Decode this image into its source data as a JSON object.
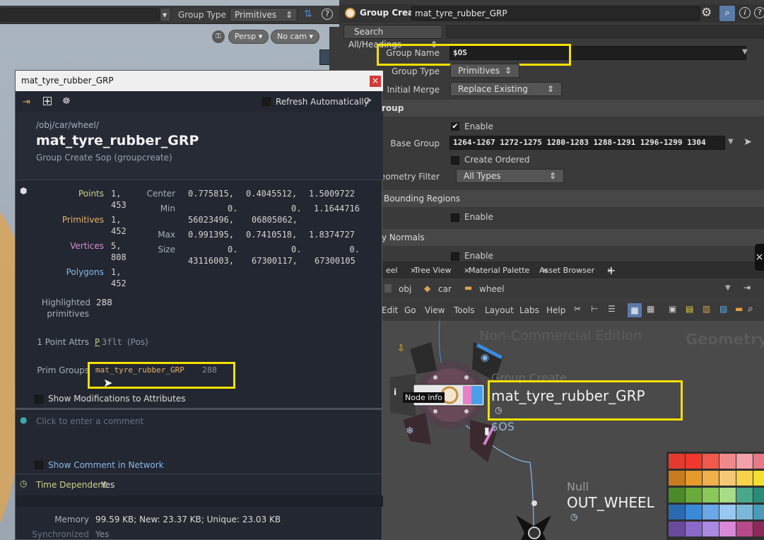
{
  "viewport": {
    "group_type_label": "Group Type",
    "group_type_value": "Primitives",
    "persp": "Persp",
    "nocam": "No cam"
  },
  "param": {
    "node_type": "Group Create",
    "node_name": "mat_tyre_rubber_GRP",
    "search": "Search All/Headings",
    "group_name_label": "Group Name",
    "group_name_value": "$OS",
    "group_type_label": "Group Type",
    "group_type_value": "Primitives",
    "initial_merge_label": "Initial Merge",
    "initial_merge_value": "Replace Existing",
    "section_group": "roup",
    "enable_label": "Enable",
    "base_group_label": "Base Group",
    "base_group_value": "1264-1267 1272-1275 1280-1283 1288-1291 1296-1299 1304",
    "create_ordered_label": "Create Ordered",
    "geometry_filter_label": "Geometry Filter",
    "geometry_filter_value": "All Types",
    "section_bounding": "Bounding Regions",
    "enable2_label": "Enable",
    "section_normals": "y Normals",
    "enable3_label": "Enable"
  },
  "network": {
    "tabs": [
      "eel",
      "Tree View",
      "Material Palette",
      "Asset Browser"
    ],
    "path": [
      "obj",
      "car",
      "wheel"
    ],
    "menu": [
      "Edit",
      "Go",
      "View",
      "Tools",
      "Layout",
      "Labs",
      "Help"
    ],
    "watermark": "Non-Commercial Edition",
    "context_label": "Geometry",
    "node_type": "Group Create",
    "node_name": "mat_tyre_rubber_GRP",
    "node_sub": "$OS",
    "node_info_tip": "Node info",
    "null_type": "Null",
    "null_name": "OUT_WHEEL"
  },
  "info": {
    "title": "mat_tyre_rubber_GRP",
    "refresh": "Refresh Automatically",
    "path": "/obj/car/wheel/",
    "name": "mat_tyre_rubber_GRP",
    "type": "Group Create Sop (groupcreate)",
    "stats": [
      {
        "label": "Points",
        "v1": "1,",
        "v2": "453",
        "color": "#c8d48a"
      },
      {
        "label": "Primitives",
        "v1": "1,",
        "v2": "452",
        "color": "#e6b26a"
      },
      {
        "label": "Vertices",
        "v1": "5,",
        "v2": "808",
        "color": "#d88fd0"
      },
      {
        "label": "Polygons",
        "v1": "1,",
        "v2": "452",
        "color": "#88b8e8"
      }
    ],
    "bounds": {
      "center_label": "Center",
      "center": [
        "0.775815,",
        "0.4045512,",
        "1.5009722"
      ],
      "min_label": "Min",
      "min1": [
        "0.",
        "0.",
        "1.1644716"
      ],
      "min2": [
        "56023496,",
        "06805062,",
        ""
      ],
      "max_label": "Max",
      "max": [
        "0.991395,",
        "0.7410518,",
        "1.8374727"
      ],
      "size_label": "Size",
      "size1": [
        "0.",
        "0.",
        "0."
      ],
      "size2": [
        "43116003,",
        "67300117,",
        "67300105"
      ]
    },
    "highlighted_label": "Highlighted",
    "highlighted_label2": "primitives",
    "highlighted_value": "288",
    "point_attrs_label": "1 Point Attrs",
    "point_attr_p": "P",
    "point_attr_type": "3flt",
    "point_attr_pos": "(Pos)",
    "prim_groups_label": "Prim Groups",
    "prim_group_name": "mat_tyre_rubber_GRP",
    "prim_group_count": "288",
    "show_mods": "Show Modifications to Attributes",
    "comment_placeholder": "Click to enter a comment",
    "show_comment": "Show Comment in Network",
    "time_dep_label": "Time Dependent",
    "time_dep_value": "Yes",
    "memory_label": "Memory",
    "memory_value": "99.59 KB; New: 23.37 KB; Unique: 23.03 KB",
    "sync_label": "Synchronized",
    "sync_value": "Yes"
  },
  "palette": [
    "#e53a2f",
    "#f0382c",
    "#ef5a4a",
    "#f08a8a",
    "#f3a0a8",
    "#e67a8a",
    "#c87b1f",
    "#e59a2a",
    "#f0b04a",
    "#f5c878",
    "#f7d24a",
    "#f2e030",
    "#4a8a2a",
    "#6aaa3a",
    "#8ac85a",
    "#a8dc88",
    "#4aa88a",
    "#2a8a78",
    "#2a6ab0",
    "#3a8ad8",
    "#6aa8e8",
    "#9ac8f0",
    "#7ab8d8",
    "#4a9ab8",
    "#6a4a9a",
    "#8a6ac8",
    "#aa8ae0",
    "#d88ad8",
    "#b84a8a",
    "#8a2a5a"
  ]
}
